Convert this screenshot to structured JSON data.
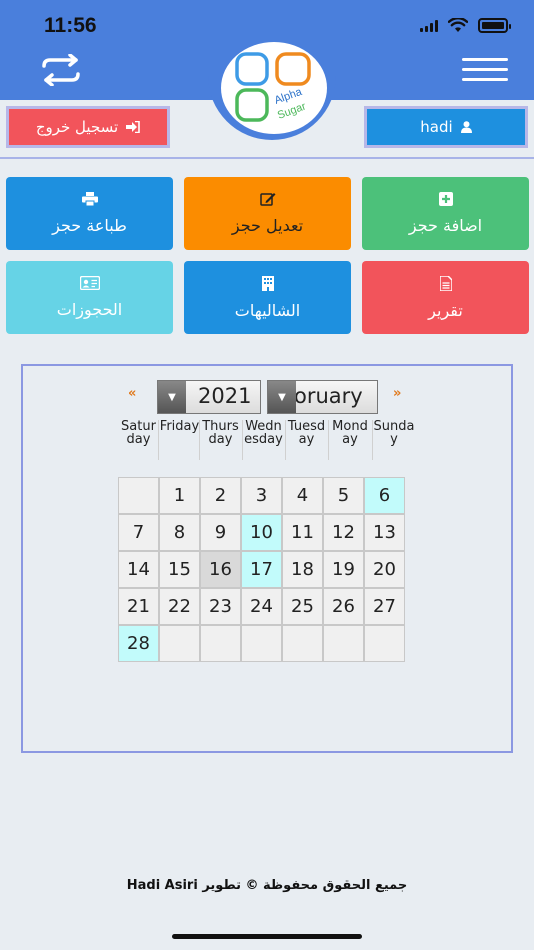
{
  "status_bar": {
    "time": "11:56"
  },
  "logo": {
    "text_line1": "Alpha",
    "text_line2": "Sugar"
  },
  "top_actions": {
    "logout_label": "تسجيل خروج",
    "user_label": "hadi"
  },
  "tiles": [
    {
      "id": "print",
      "label": "طباعة حجز",
      "icon": "printer-icon",
      "color": "#1e90df"
    },
    {
      "id": "edit",
      "label": "تعديل حجز",
      "icon": "edit-icon",
      "color": "#fb8c00"
    },
    {
      "id": "add",
      "label": "اضافة حجز",
      "icon": "plus-icon",
      "color": "#4cc17a"
    },
    {
      "id": "bookings",
      "label": "الحجوزات",
      "icon": "id-card-icon",
      "color": "#66d3e6"
    },
    {
      "id": "chalets",
      "label": "الشاليهات",
      "icon": "building-icon",
      "color": "#1e90df"
    },
    {
      "id": "report",
      "label": "تقرير",
      "icon": "document-icon",
      "color": "#f2545b"
    }
  ],
  "calendar": {
    "prev_label": "«",
    "next_label": "»",
    "year": "2021",
    "month_visible_text": "oruary",
    "weekdays": [
      "Saturday",
      "Friday",
      "Thursday",
      "Wednesday",
      "Tuesday",
      "Monday",
      "Sunday"
    ],
    "weeks": [
      [
        null,
        "1",
        "2",
        "3",
        "4",
        "5",
        "6"
      ],
      [
        "7",
        "8",
        "9",
        "10",
        "11",
        "12",
        "13"
      ],
      [
        "14",
        "15",
        "16",
        "17",
        "18",
        "19",
        "20"
      ],
      [
        "21",
        "22",
        "23",
        "24",
        "25",
        "26",
        "27"
      ],
      [
        "28",
        null,
        null,
        null,
        null,
        null,
        null
      ]
    ],
    "highlighted_days": [
      "6",
      "10",
      "17",
      "28"
    ],
    "today": "16"
  },
  "footer": {
    "text": "جميع الحقوق محفوظة © تطوير Hadi Asiri"
  }
}
